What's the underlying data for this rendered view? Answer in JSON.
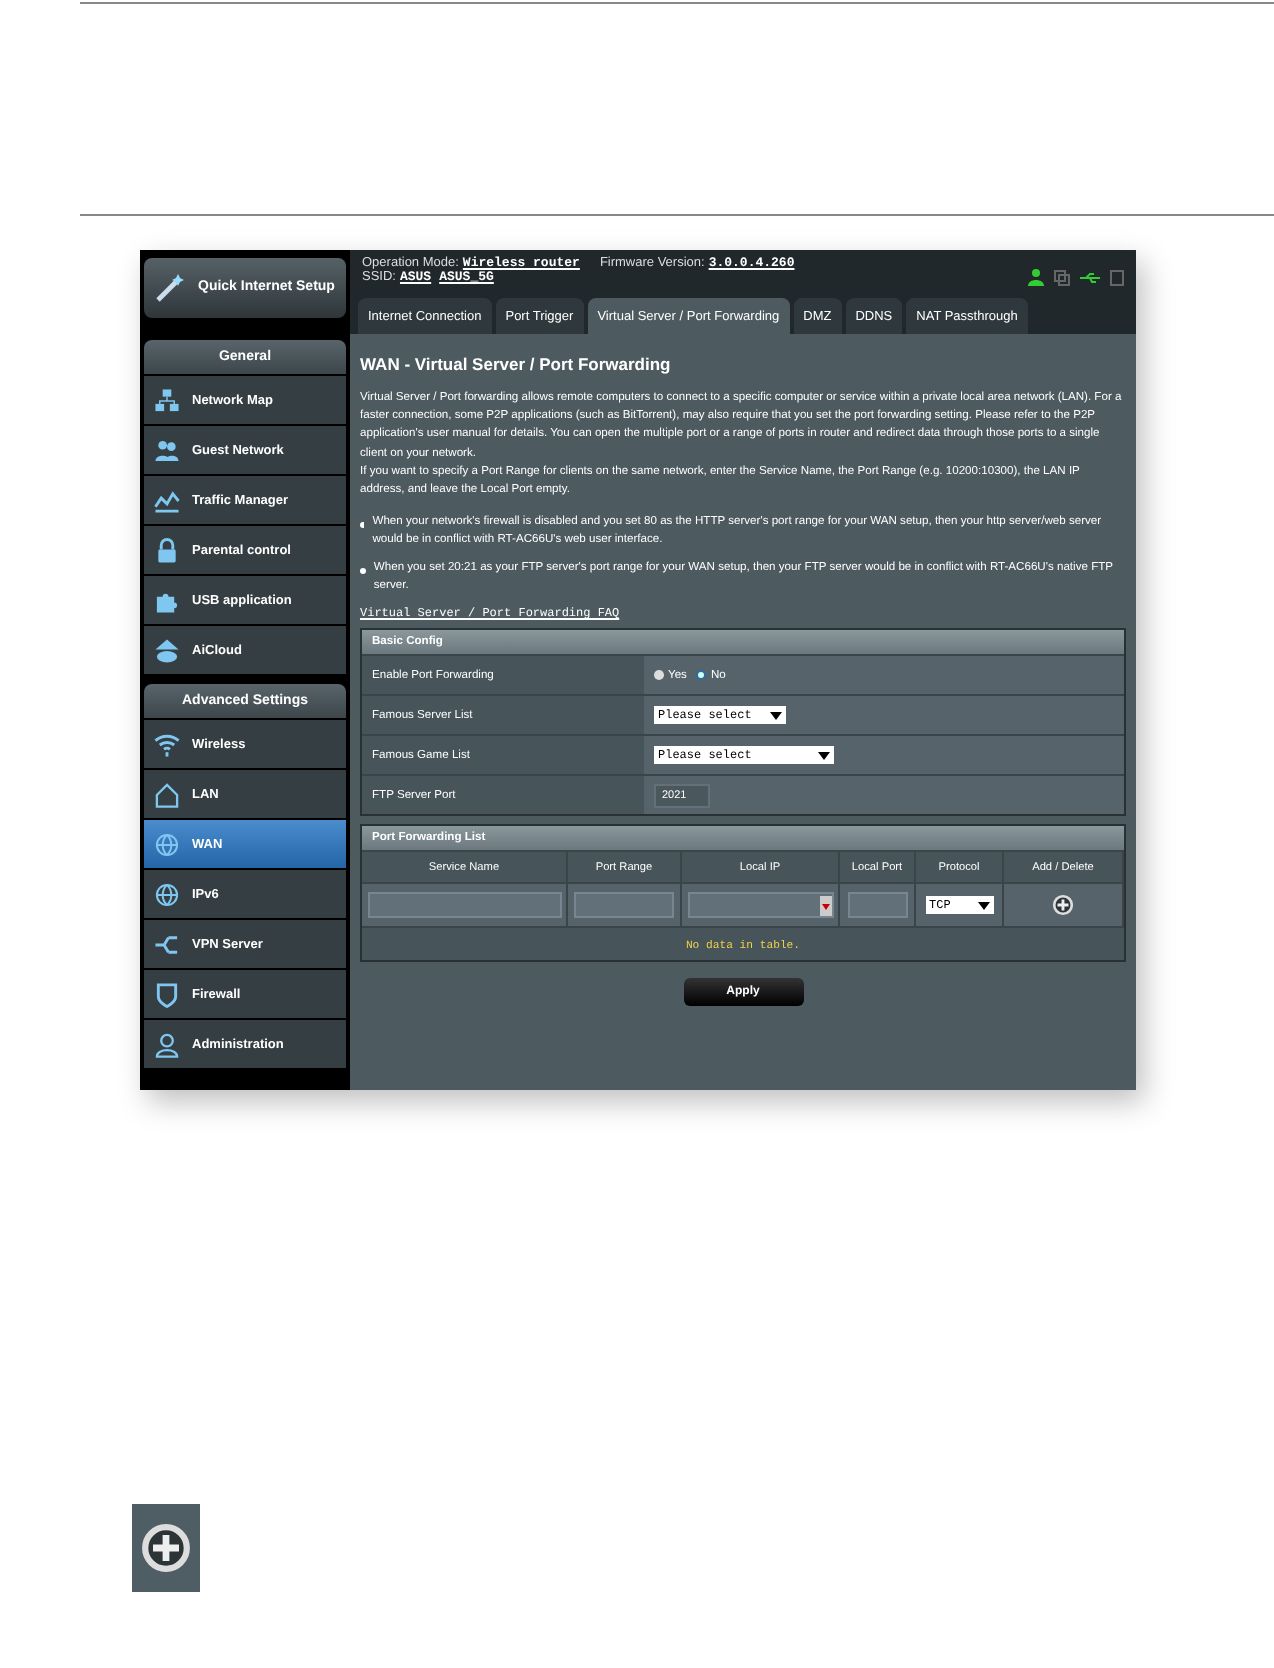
{
  "router_ui": {
    "header": {
      "operation_mode_label": "Operation Mode:",
      "operation_mode": "Wireless router",
      "firmware_label": "Firmware Version:",
      "firmware": "3.0.0.4.260",
      "ssid_label": "SSID:",
      "ssids": [
        "ASUS",
        "ASUS_5G"
      ]
    },
    "quick_setup": "Quick Internet Setup",
    "sidebar": [
      {
        "title": "General",
        "items": [
          {
            "label": "Network Map",
            "selected": false
          },
          {
            "label": "Guest Network",
            "selected": false
          },
          {
            "label": "Traffic Manager",
            "selected": false
          },
          {
            "label": "Parental control",
            "selected": false
          },
          {
            "label": "USB application",
            "selected": false
          },
          {
            "label": "AiCloud",
            "selected": false
          }
        ]
      },
      {
        "title": "Advanced Settings",
        "items": [
          {
            "label": "Wireless",
            "selected": false
          },
          {
            "label": "LAN",
            "selected": false
          },
          {
            "label": "WAN",
            "selected": true
          },
          {
            "label": "IPv6",
            "selected": false
          },
          {
            "label": "VPN Server",
            "selected": false
          },
          {
            "label": "Firewall",
            "selected": false
          },
          {
            "label": "Administration",
            "selected": false
          }
        ]
      }
    ],
    "tabs": [
      {
        "label": "Internet Connection",
        "selected": false
      },
      {
        "label": "Port Trigger",
        "selected": false
      },
      {
        "label": "Virtual Server / Port Forwarding",
        "selected": true
      },
      {
        "label": "DMZ",
        "selected": false
      },
      {
        "label": "DDNS",
        "selected": false
      },
      {
        "label": "NAT Passthrough",
        "selected": false
      }
    ],
    "title": "WAN - Virtual Server / Port Forwarding",
    "description": [
      "Virtual Server / Port forwarding allows remote computers to connect to a specific computer or service within a private local area network (LAN). For a faster connection, some P2P applications (such as BitTorrent), may also require that you set the port forwarding setting. Please refer to the P2P application's user manual for details. You can open the multiple port or a range of ports in router and redirect data through those ports to a single client on your network.",
      "If you want to specify a Port Range for clients on the same network, enter the Service Name, the Port Range (e.g. 10200:10300), the LAN IP address, and leave the Local Port empty."
    ],
    "notes": [
      "When your network's firewall is disabled and you set 80 as the HTTP server's port range for your WAN setup, then your http server/web server would be in conflict with RT-AC66U's web user interface.",
      "When you set 20:21 as your FTP server's port range for your WAN setup, then your FTP server would be in conflict with RT-AC66U's native FTP server."
    ],
    "faq_link": "Virtual Server / Port Forwarding FAQ",
    "basic_config": {
      "title": "Basic Config",
      "rows": [
        {
          "kind": "radio",
          "label": "Enable Port Forwarding",
          "options": [
            {
              "label": "Yes",
              "selected": false
            },
            {
              "label": "No",
              "selected": true
            }
          ]
        },
        {
          "kind": "select",
          "label": "Famous Server List",
          "value": "Please select"
        },
        {
          "kind": "select_wide",
          "label": "Famous Game List",
          "value": "Please select"
        },
        {
          "kind": "text",
          "label": "FTP Server Port",
          "value": "2021"
        }
      ]
    },
    "port_forwarding_list": {
      "title": "Port Forwarding List",
      "columns": [
        "Service Name",
        "Port Range",
        "Local IP",
        "Local Port",
        "Protocol",
        "Add / Delete"
      ],
      "protocol": "TCP",
      "empty_message": "No data in table."
    },
    "apply": "Apply"
  }
}
